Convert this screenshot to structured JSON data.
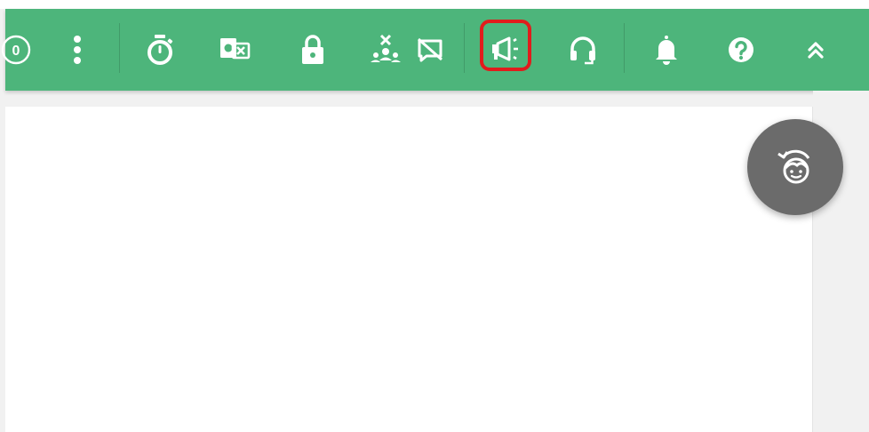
{
  "toolbar": {
    "background": "#4db57b",
    "icon_color": "#ffffff",
    "counter_value": "0",
    "items": [
      {
        "icon": "counter-badge-icon"
      },
      {
        "icon": "more-vertical-icon"
      },
      {
        "icon": "stopwatch-icon"
      },
      {
        "icon": "screen-share-icon"
      },
      {
        "icon": "lock-icon"
      },
      {
        "icon": "remove-participants-icon"
      },
      {
        "icon": "chat-disabled-icon"
      },
      {
        "icon": "megaphone-icon",
        "highlighted": true
      },
      {
        "icon": "headset-icon"
      },
      {
        "icon": "bell-icon"
      },
      {
        "icon": "help-icon"
      },
      {
        "icon": "double-chevron-up-icon"
      }
    ]
  },
  "highlight_color": "#e11c1c",
  "floating_button": {
    "icon": "avatar-rotate-icon",
    "background": "#6b6b6b"
  }
}
